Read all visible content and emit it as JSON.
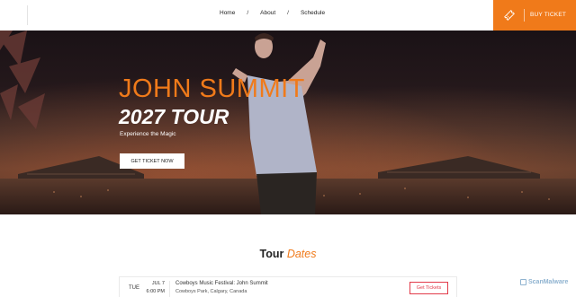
{
  "nav": {
    "home": "Home",
    "about": "About",
    "schedule": "Schedule",
    "separator": "/"
  },
  "header": {
    "buy_ticket": "BUY TICKET",
    "buy_icon": "ticket-icon",
    "accent_color": "#f07a1a"
  },
  "hero": {
    "title": "JOHN SUMMIT",
    "subtitle": "2027 TOUR",
    "tagline": "Experience the Magic",
    "cta": "GET TICKET NOW"
  },
  "tour": {
    "heading_main": "Tour",
    "heading_accent": "Dates",
    "events": [
      {
        "day": "TUE",
        "date": "JUL 7",
        "time": "6:00 PM",
        "name": "Cowboys Music Festival: John Summit",
        "venue": "Cowboys Park, Calgary, Canada",
        "button": "Get Tickets"
      }
    ]
  },
  "watermark": {
    "text": "ScanMalware"
  }
}
